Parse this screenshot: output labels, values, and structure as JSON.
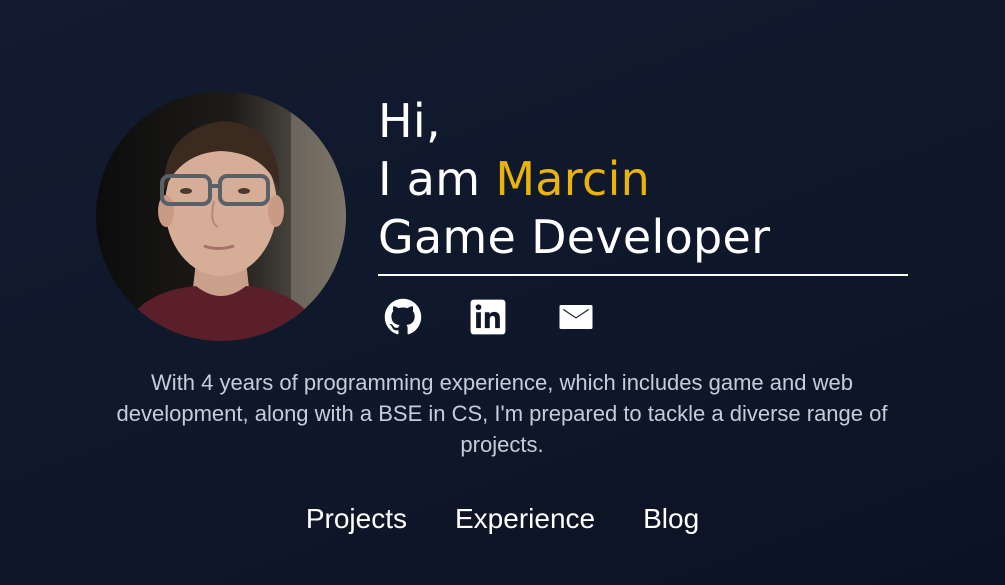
{
  "profile": {
    "avatar_icon": "profile-photo"
  },
  "hero": {
    "greeting": "Hi,",
    "intro_prefix": "I am ",
    "name": "Marcin",
    "role": "Game Developer",
    "accent_color": "#eab308"
  },
  "socials": [
    {
      "icon": "github-icon",
      "label": "GitHub"
    },
    {
      "icon": "linkedin-icon",
      "label": "LinkedIn"
    },
    {
      "icon": "mail-icon",
      "label": "Email"
    }
  ],
  "bio": "With 4 years of programming experience, which includes game and web development, along with a BSE in CS, I'm prepared to tackle a diverse range of projects.",
  "nav": {
    "items": [
      {
        "label": "Projects"
      },
      {
        "label": "Experience"
      },
      {
        "label": "Blog"
      }
    ]
  }
}
